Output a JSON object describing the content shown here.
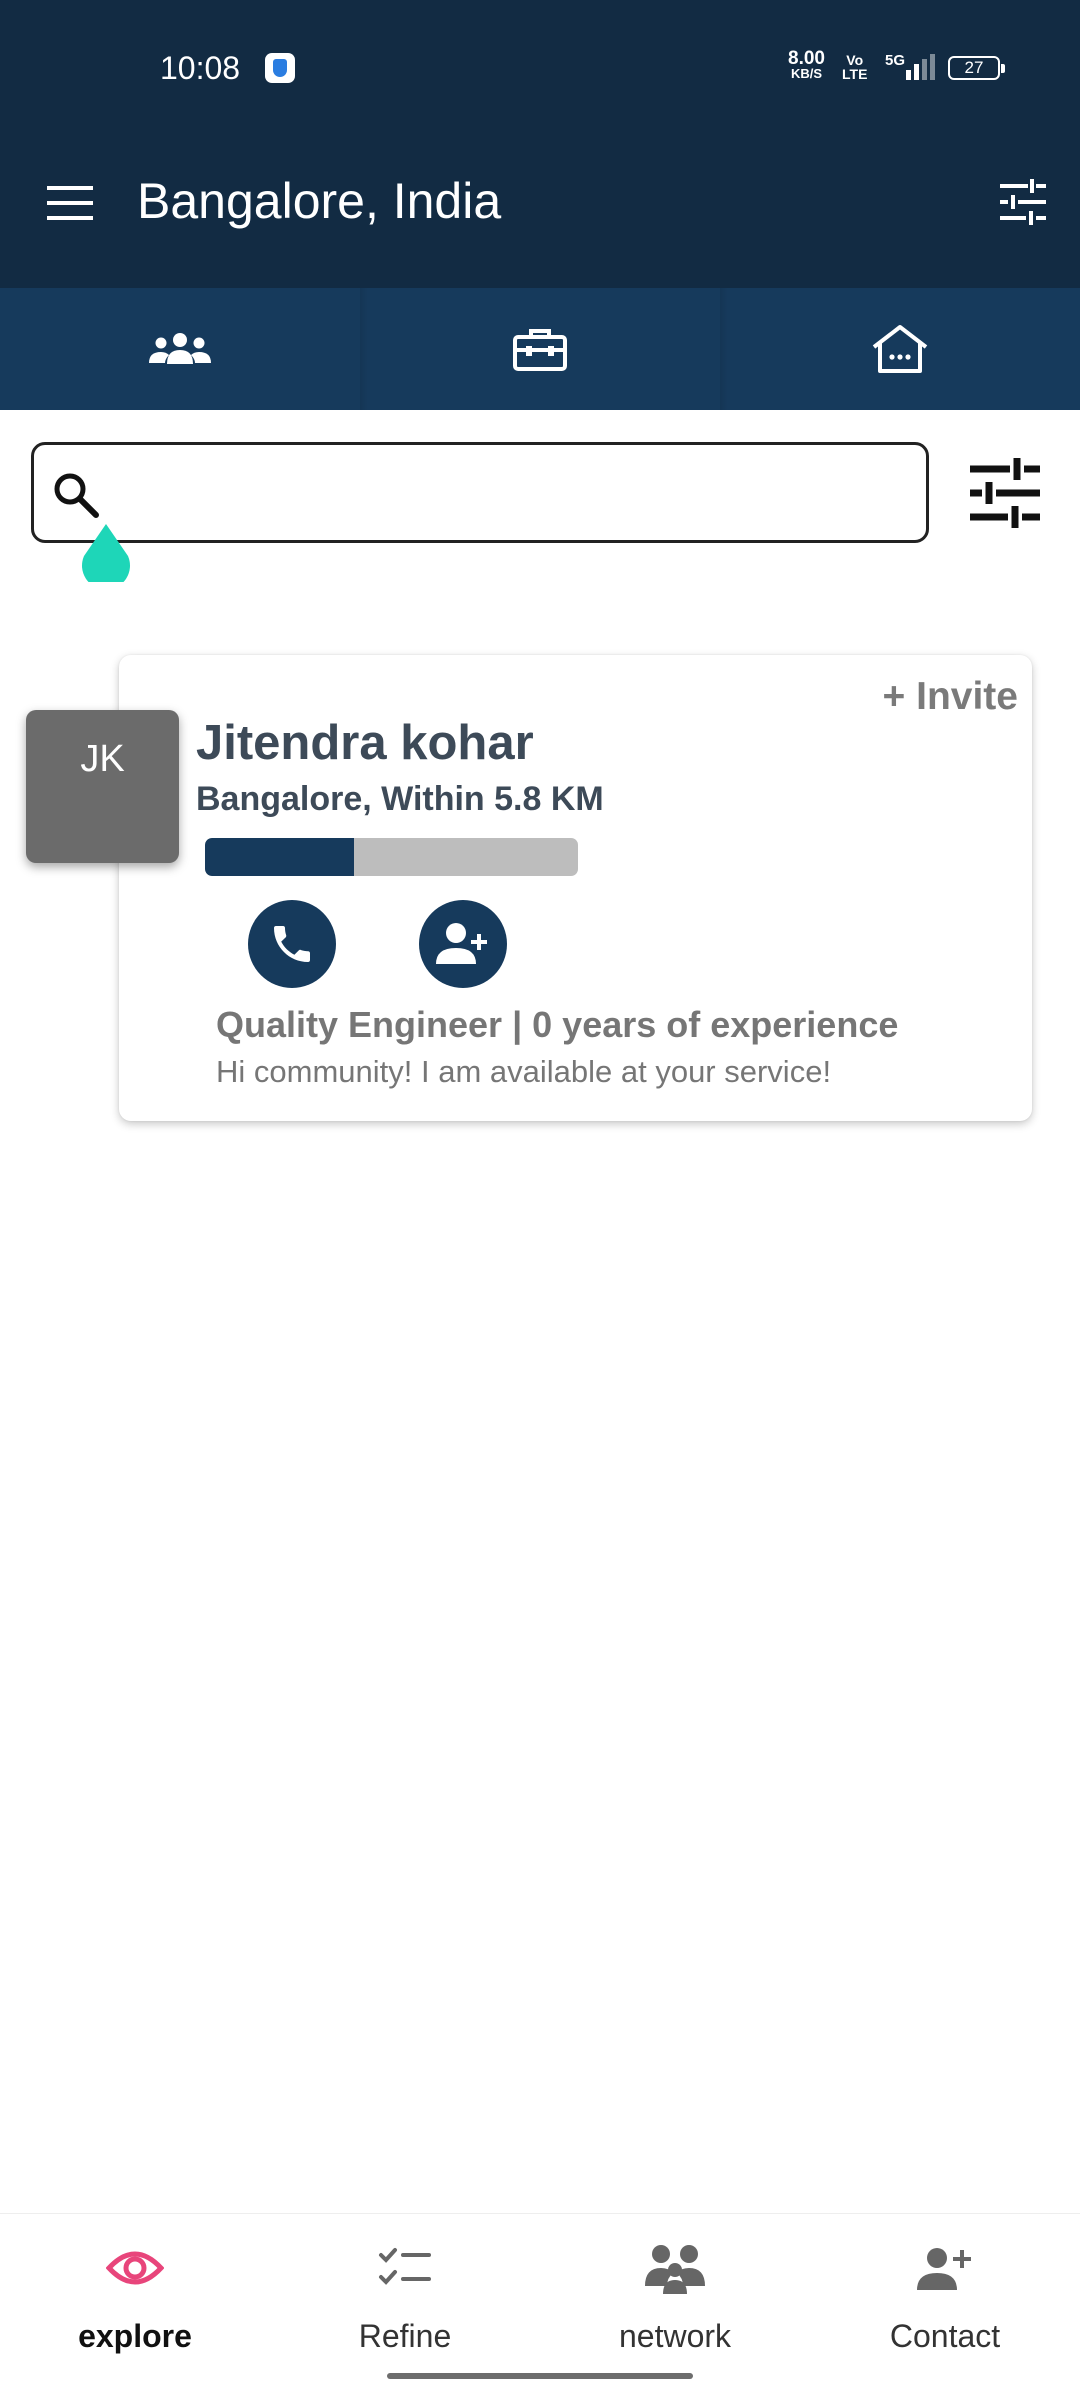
{
  "status_bar": {
    "time": "10:08",
    "net_speed_value": "8.00",
    "net_speed_unit": "KB/S",
    "volte_top": "Vo",
    "volte_bottom": "LTE",
    "network": "5G",
    "battery": "27"
  },
  "app_bar": {
    "title": "Bangalore, India",
    "menu_icon": "hamburger-menu-icon",
    "action_icon": "tune-sliders-icon"
  },
  "tabs": [
    {
      "icon": "people-group-icon",
      "selected": false
    },
    {
      "icon": "briefcase-icon",
      "selected": false
    },
    {
      "icon": "home-icon",
      "selected": false
    }
  ],
  "search": {
    "value": "",
    "placeholder": "",
    "icon": "search-icon"
  },
  "profiles": [
    {
      "initials": "JK",
      "name": "Jitendra kohar",
      "location": "Bangalore, Within 5.8 KM",
      "invite_label": "+ Invite",
      "profile_completion": 0.4,
      "job_line": "Quality Engineer | 0 years of experience",
      "bio": "Hi community! I am available at your service!",
      "actions": [
        "phone-icon",
        "add-person-icon"
      ]
    }
  ],
  "bottom_nav": [
    {
      "label": "explore",
      "icon": "eye-icon",
      "active": true
    },
    {
      "label": "Refine",
      "icon": "checklist-icon",
      "active": false
    },
    {
      "label": "network",
      "icon": "network-group-icon",
      "active": false
    },
    {
      "label": "Contact",
      "icon": "add-contact-icon",
      "active": false
    }
  ],
  "colors": {
    "primary_dark": "#122b43",
    "tab_bar": "#163a5c",
    "accent_active": "#e8457b",
    "cursor_handle": "#1ed6b8",
    "avatar_bg": "#6b6b6b"
  }
}
